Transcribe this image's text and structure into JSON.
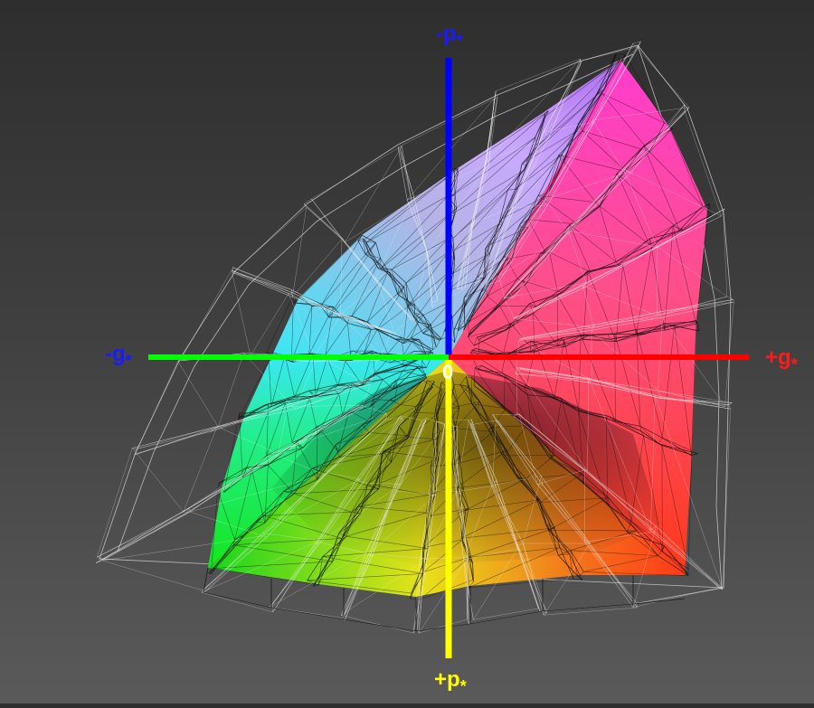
{
  "diagram": {
    "axes": {
      "minus_p": {
        "base": "-p",
        "sub": "*",
        "color": "#1a1aff"
      },
      "plus_p": {
        "base": "+p",
        "sub": "*",
        "color": "#ffff00"
      },
      "minus_g": {
        "base": "-g",
        "sub": "*",
        "color": "#1a1aff"
      },
      "plus_g": {
        "base": "+g",
        "sub": "*",
        "color": "#ff1a1a"
      },
      "origin": {
        "label": "0",
        "color": "#ffffff"
      }
    },
    "axis_line_colors": {
      "minus_p": "#0000ff",
      "plus_p": "#ffff00",
      "minus_g": "#00ff00",
      "plus_g": "#ff0000"
    },
    "gamut_colors": {
      "cyan": "#39e8f5",
      "lavender": "#c9a8ff",
      "violet": "#b06cf0",
      "magenta": "#ff3ccf",
      "pink": "#ff4f8a",
      "red": "#ff3a18",
      "orange": "#f27a1c",
      "yellow": "#e8e21a",
      "green": "#14e61c",
      "gray": "#8a8a8a"
    }
  }
}
